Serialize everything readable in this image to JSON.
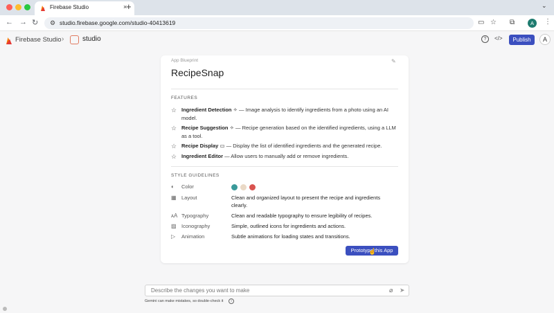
{
  "browser": {
    "tab_title": "Firebase Studio",
    "close_glyph": "×",
    "new_tab_glyph": "+",
    "url": "studio.firebase.google.com/studio-40413619",
    "profile_initial": "A"
  },
  "header": {
    "brand": "Firebase Studio",
    "project": "studio",
    "publish_label": "Publish",
    "avatar_initial": "A"
  },
  "blueprint": {
    "label": "App Blueprint",
    "title": "RecipeSnap",
    "features_heading": "FEATURES",
    "features": [
      {
        "name": "Ingredient Detection",
        "icon": "sparkle-icon",
        "desc": " — Image analysis to identify ingredients from a photo using an AI model."
      },
      {
        "name": "Recipe Suggestion",
        "icon": "sparkle-icon",
        "desc": " — Recipe generation based on the identified ingredients, using a LLM as a tool."
      },
      {
        "name": "Recipe Display",
        "icon": "window-icon",
        "desc": " — Display the list of identified ingredients and the generated recipe."
      },
      {
        "name": "Ingredient Editor",
        "icon": "",
        "desc": " — Allow users to manually add or remove ingredients."
      }
    ],
    "style_heading": "STYLE GUIDELINES",
    "style": {
      "color_label": "Color",
      "colors": [
        "#3a9a9a",
        "#ead9c6",
        "#d9534f"
      ],
      "layout_label": "Layout",
      "layout_value": "Clean and organized layout to present the recipe and ingredients clearly.",
      "typography_label": "Typography",
      "typography_value": "Clean and readable typography to ensure legibility of recipes.",
      "iconography_label": "Iconography",
      "iconography_value": "Simple, outlined icons for ingredients and actions.",
      "animation_label": "Animation",
      "animation_value": "Subtle animations for loading states and transitions."
    },
    "prototype_label": "Prototype this App"
  },
  "prompt": {
    "placeholder": "Describe the changes you want to make",
    "disclaimer": "Gemini can make mistakes, so double-check it"
  }
}
